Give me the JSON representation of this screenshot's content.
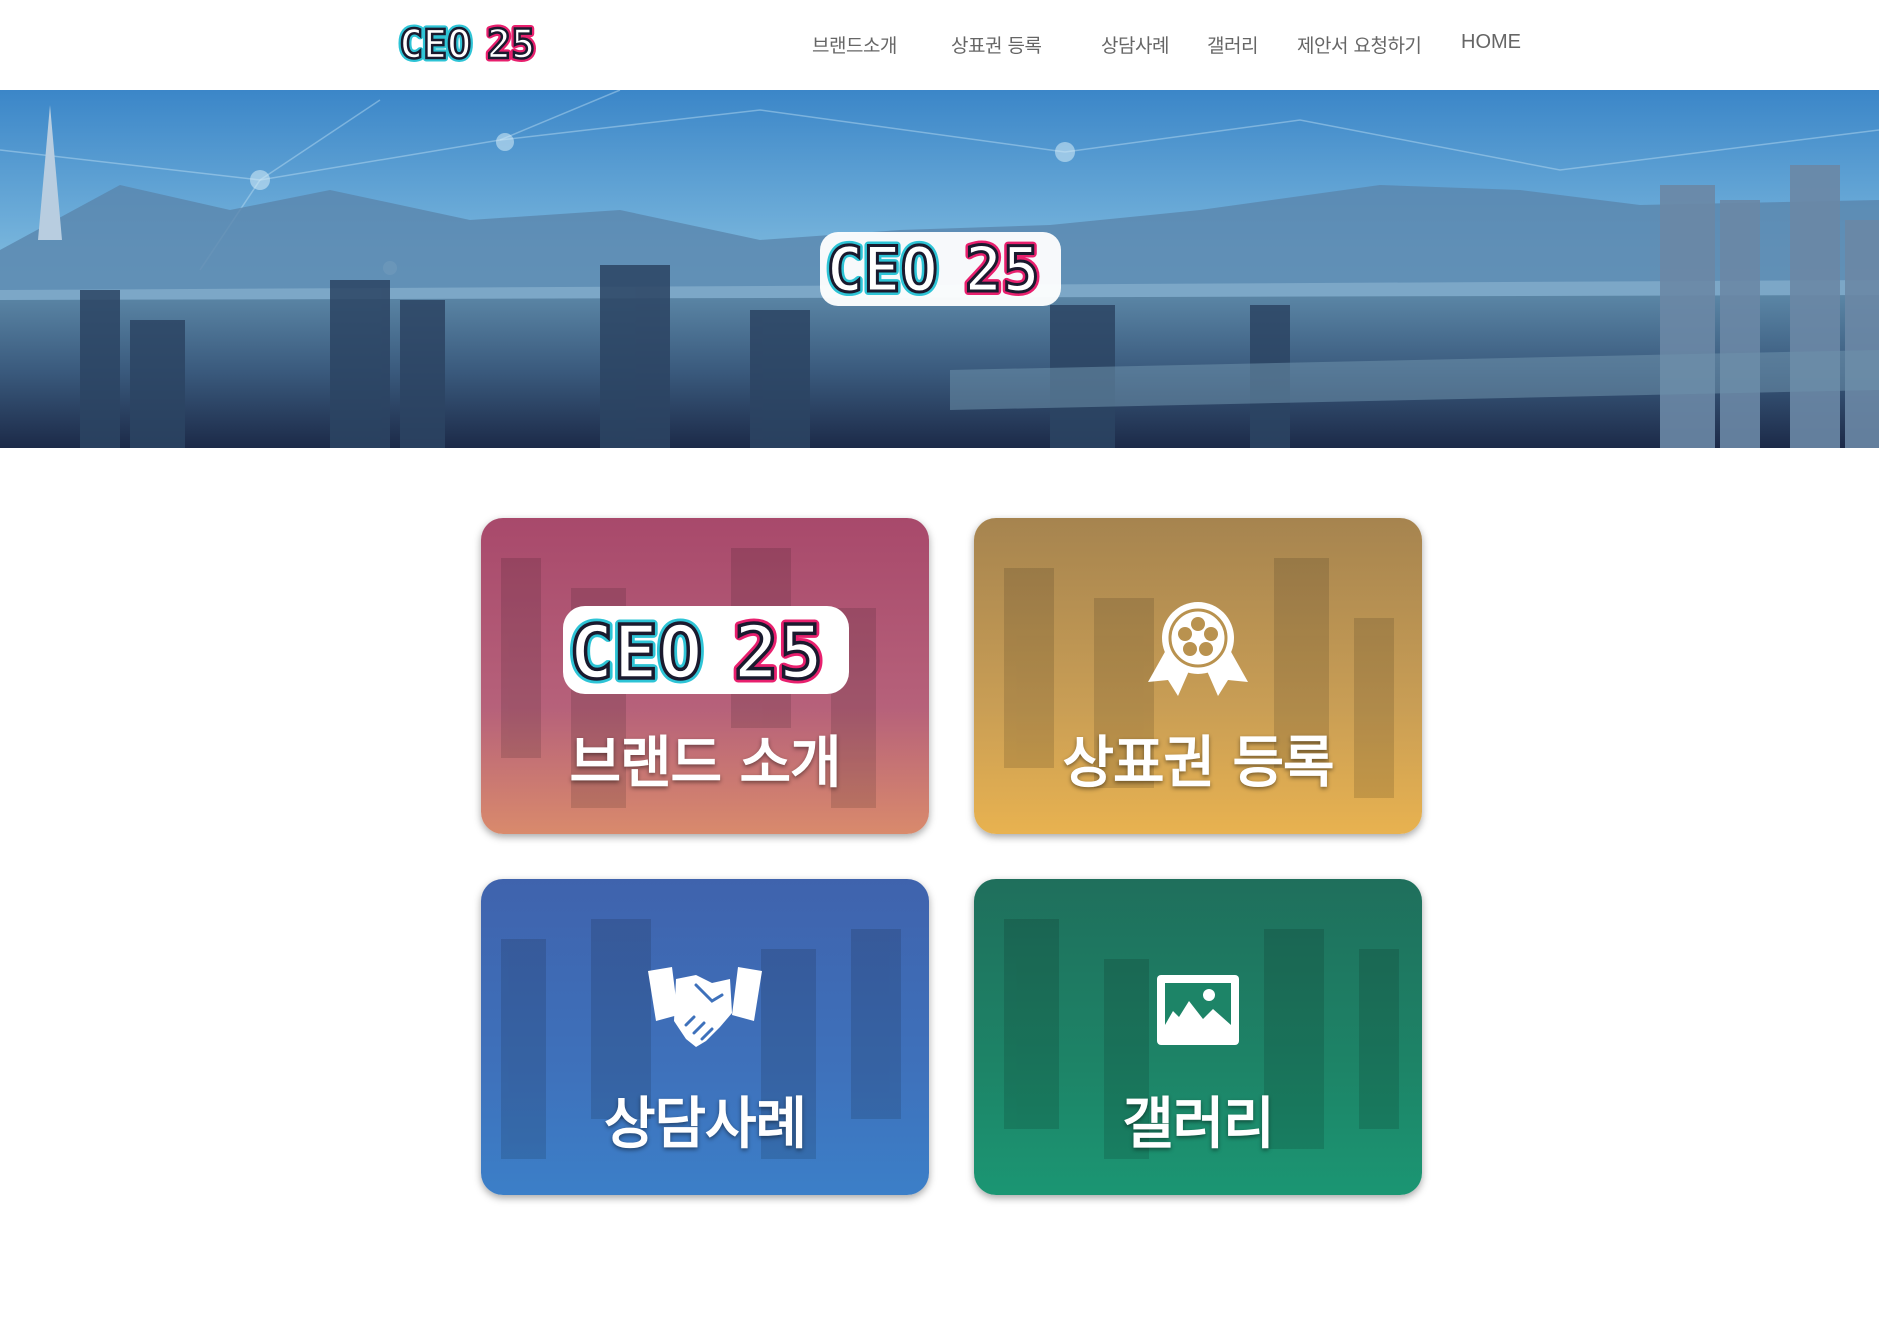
{
  "header": {
    "logo_text": "CEO 25",
    "nav": [
      {
        "label": "브랜드소개"
      },
      {
        "label": "상표권 등록"
      },
      {
        "label": "상담사례"
      },
      {
        "label": "갤러리"
      },
      {
        "label": "제안서 요청하기"
      },
      {
        "label": "HOME"
      }
    ]
  },
  "hero": {
    "logo_text": "CEO 25"
  },
  "cards": [
    {
      "title": "브랜드 소개",
      "icon": "ceo25-logo-icon",
      "color_top": "#a8496b",
      "color_bottom": "#d98a6c"
    },
    {
      "title": "상표권 등록",
      "icon": "award-badge-icon",
      "color_top": "#a6844f",
      "color_bottom": "#e8b250"
    },
    {
      "title": "상담사례",
      "icon": "handshake-icon",
      "color_top": "#3f63ad",
      "color_bottom": "#3c7fc8"
    },
    {
      "title": "갤러리",
      "icon": "picture-frame-icon",
      "color_top": "#1f6f5c",
      "color_bottom": "#1b9673"
    }
  ],
  "colors": {
    "logo_cyan": "#2ec4d6",
    "logo_pink": "#e8206e",
    "nav_text": "#666666"
  }
}
